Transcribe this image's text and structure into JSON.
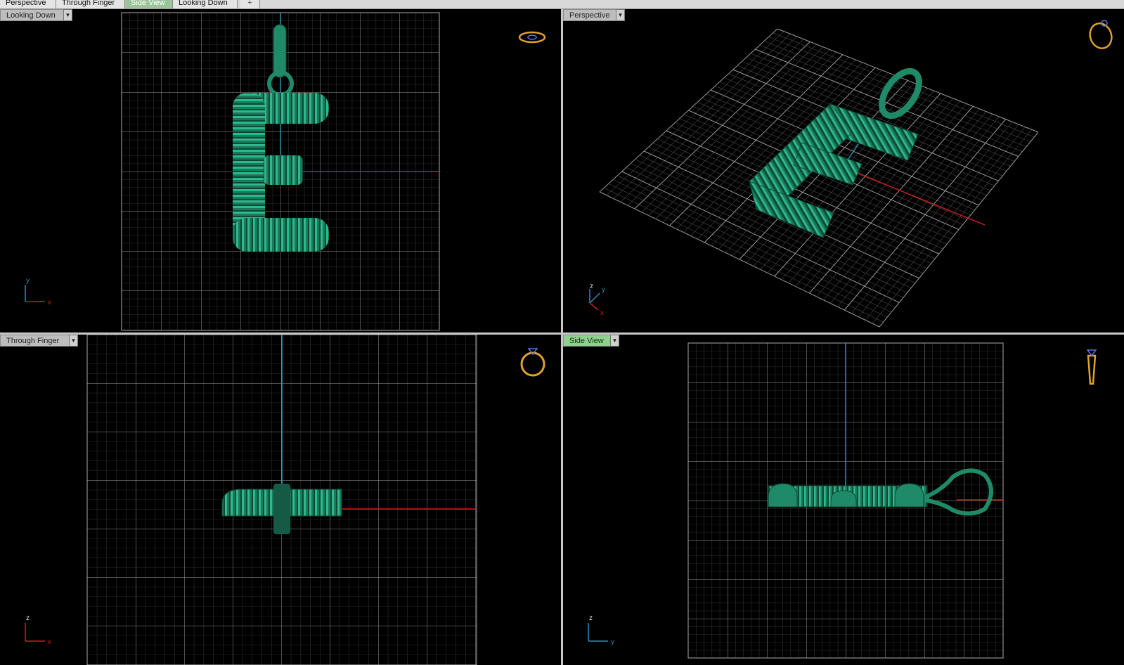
{
  "tabs": [
    {
      "label": "Perspective"
    },
    {
      "label": "Through Finger"
    },
    {
      "label": "Side View"
    },
    {
      "label": "Looking Down"
    }
  ],
  "tab_add_label": "+",
  "active_tab": "Side View",
  "viewports": {
    "top_left": {
      "label": "Looking Down",
      "axes": [
        "y",
        "x"
      ],
      "icon": "ring-top-view-icon"
    },
    "top_right": {
      "label": "Perspective",
      "axes": [
        "z",
        "y",
        "x"
      ],
      "icon": "ring-perspective-icon"
    },
    "bottom_left": {
      "label": "Through Finger",
      "axes": [
        "z",
        "x"
      ],
      "icon": "ring-front-view-icon"
    },
    "bottom_right": {
      "label": "Side View",
      "axes": [
        "z",
        "y"
      ],
      "icon": "ring-side-view-icon"
    }
  },
  "colors": {
    "model": "#1f8a68",
    "grid": "#8a8a8a",
    "axis_red": "#c81e1e",
    "axis_blue": "#2f8fb0",
    "active_label": "#8fd08f",
    "icon_gold": "#e0a030"
  }
}
